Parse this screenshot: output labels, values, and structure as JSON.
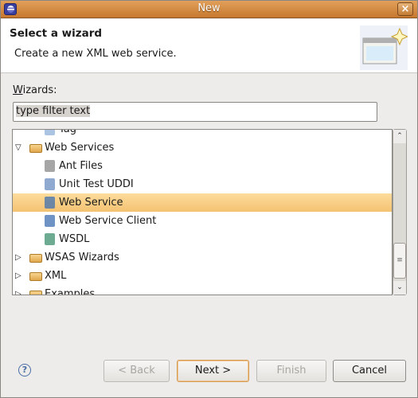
{
  "window": {
    "title": "New",
    "close_icon": "×"
  },
  "header": {
    "title": "Select a wizard",
    "description": "Create a new XML web service."
  },
  "wizards_label": {
    "mnemonic": "W",
    "rest": "izards:"
  },
  "filter": {
    "value": "type filter text"
  },
  "tree": {
    "items": [
      {
        "label": "Tag",
        "level": 1,
        "icon": "tag-icon"
      },
      {
        "label": "Web Services",
        "level": 0,
        "icon": "folder-icon",
        "expanded": true
      },
      {
        "label": "Ant Files",
        "level": 1,
        "icon": "ant-icon"
      },
      {
        "label": "Unit Test UDDI",
        "level": 1,
        "icon": "document-icon"
      },
      {
        "label": "Web Service",
        "level": 1,
        "icon": "web-service-icon",
        "selected": true
      },
      {
        "label": "Web Service Client",
        "level": 1,
        "icon": "web-service-client-icon"
      },
      {
        "label": "WSDL",
        "level": 1,
        "icon": "wsdl-icon"
      },
      {
        "label": "WSAS Wizards",
        "level": 0,
        "icon": "folder-icon",
        "expanded": false
      },
      {
        "label": "XML",
        "level": 0,
        "icon": "folder-icon",
        "expanded": false
      },
      {
        "label": "Examples",
        "level": 0,
        "icon": "folder-icon",
        "expanded": false
      }
    ]
  },
  "buttons": {
    "help": "?",
    "back": "< Back",
    "next": "Next >",
    "finish": "Finish",
    "cancel": "Cancel"
  }
}
